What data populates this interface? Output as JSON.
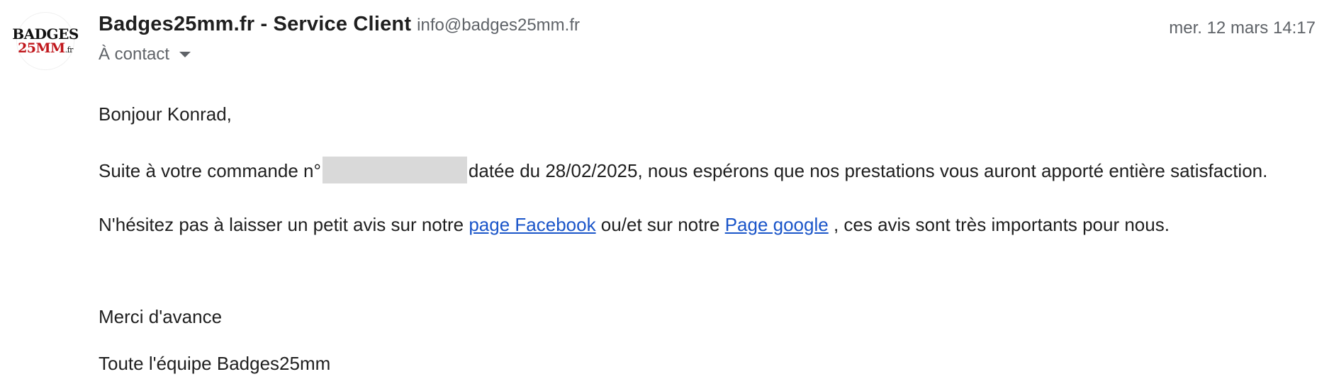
{
  "sender": {
    "avatar_top": "BADGES",
    "avatar_bottom": "25MM",
    "avatar_tld": ".fr",
    "name": "Badges25mm.fr - Service Client",
    "email": "info@badges25mm.fr",
    "recipient_label": "À contact"
  },
  "date": "mer. 12 mars 14:17",
  "body": {
    "greeting": "Bonjour Konrad,",
    "order_prefix": "Suite à votre commande n°",
    "order_suffix": "datée du 28/02/2025, nous espérons que nos prestations vous auront apporté entière satisfaction.",
    "review_prefix": "N'hésitez pas à laisser un petit avis sur notre ",
    "facebook_link": "page Facebook",
    "review_middle": " ou/et sur notre ",
    "google_link": "Page google",
    "review_suffix": " , ces avis sont très importants pour nous.",
    "thanks": "Merci d'avance",
    "signature": "Toute l'équipe Badges25mm"
  },
  "colors": {
    "link": "#1a55c9",
    "muted": "#5f6368",
    "logo_red": "#c0171c",
    "redaction": "#d9d9d9"
  }
}
